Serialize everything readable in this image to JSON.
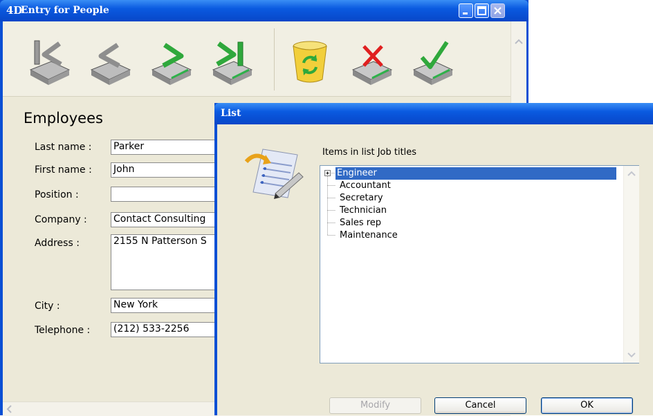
{
  "main_window": {
    "title": "Entry for People",
    "logo": "4D",
    "toolbar": [
      {
        "name": "first-record-icon",
        "label": "First record"
      },
      {
        "name": "previous-record-icon",
        "label": "Previous record"
      },
      {
        "name": "next-record-icon",
        "label": "Next record"
      },
      {
        "name": "last-record-icon",
        "label": "Last record"
      },
      {
        "name": "delete-record-icon",
        "label": "Delete record"
      },
      {
        "name": "cancel-icon",
        "label": "Cancel"
      },
      {
        "name": "accept-icon",
        "label": "Accept"
      }
    ],
    "form": {
      "title": "Employees",
      "last_name_label": "Last name :",
      "last_name_value": "Parker",
      "first_name_label": "First name :",
      "first_name_value": "John",
      "position_label": "Position :",
      "position_value": "",
      "company_label": "Company :",
      "company_value": "Contact Consulting",
      "address_label": "Address :",
      "address_value": "2155 N Patterson S",
      "city_label": "City :",
      "city_value": "New York",
      "telephone_label": "Telephone :",
      "telephone_value": "(212) 533-2256"
    }
  },
  "list_dialog": {
    "title": "List",
    "caption": "Items in list Job titles",
    "items": [
      "Engineer",
      "Accountant",
      "Secretary",
      "Technician",
      "Sales rep",
      "Maintenance"
    ],
    "selected": "Engineer",
    "modify_label": "Modify",
    "cancel_label": "Cancel",
    "ok_label": "OK"
  },
  "colors": {
    "titlebar": "#0a5ae0",
    "window_bg": "#ece9d8",
    "selection": "#316ac5"
  }
}
